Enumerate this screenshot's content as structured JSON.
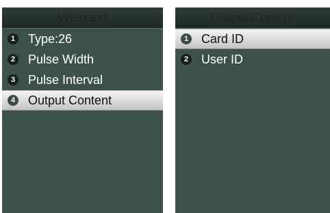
{
  "left_screen": {
    "title": "Wiegand",
    "items": [
      {
        "number": "1",
        "label": "Type:26",
        "selected": false
      },
      {
        "number": "2",
        "label": "Pulse Width",
        "selected": false
      },
      {
        "number": "3",
        "label": "Pulse Interval",
        "selected": false
      },
      {
        "number": "4",
        "label": "Output Content",
        "selected": true
      }
    ]
  },
  "right_screen": {
    "title": "Output Content",
    "items": [
      {
        "number": "1",
        "label": "Card ID",
        "selected": true
      },
      {
        "number": "2",
        "label": "User ID",
        "selected": false
      }
    ]
  },
  "colors": {
    "screen_background": "#3d504c",
    "title_bar": "#26322f",
    "selection_highlight": "#dcdcdc",
    "text": "#ffffff"
  }
}
